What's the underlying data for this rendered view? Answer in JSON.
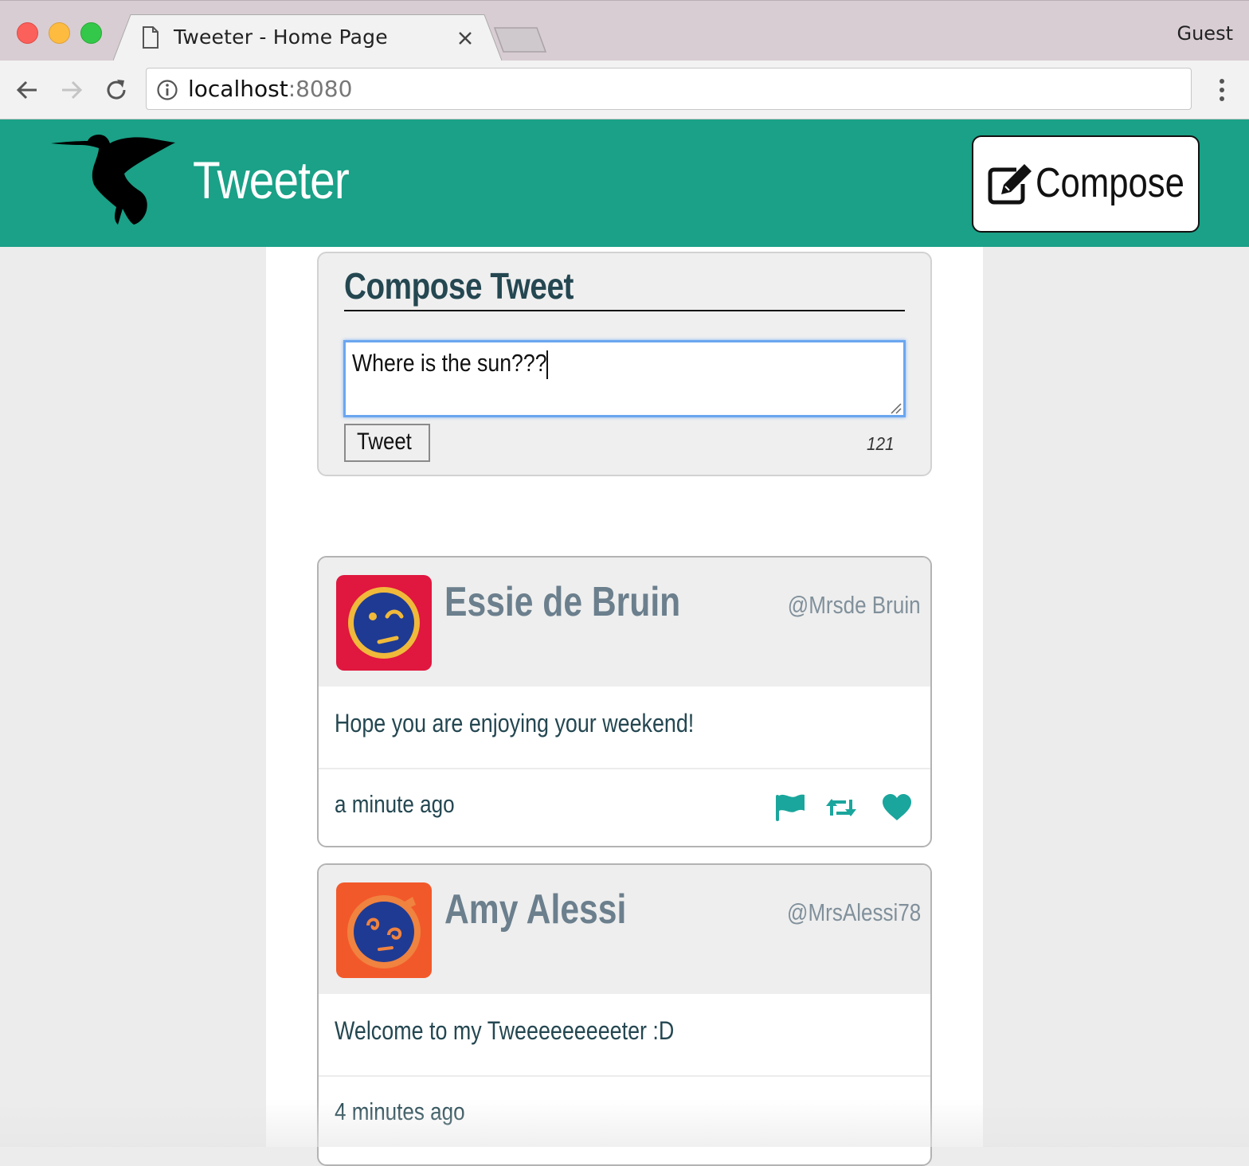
{
  "browser": {
    "tab_title": "Tweeter - Home Page",
    "profile_label": "Guest",
    "url_host": "localhost",
    "url_port": ":8080"
  },
  "header": {
    "brand": "Tweeter",
    "compose_button_label": "Compose",
    "accent_color": "#1aa187"
  },
  "compose": {
    "heading": "Compose Tweet",
    "textarea_value": "Where is the sun???",
    "submit_label": "Tweet",
    "char_counter": "121"
  },
  "tweets": [
    {
      "name": "Essie de Bruin",
      "handle": "@Mrsde Bruin",
      "text": "Hope you are enjoying your weekend!",
      "time": "a minute ago",
      "avatar_icon": "winking-face-avatar",
      "actions": [
        "flag-icon",
        "retweet-icon",
        "heart-icon"
      ]
    },
    {
      "name": "Amy Alessi",
      "handle": "@MrsAlessi78",
      "text": "Welcome to my Tweeeeeeeeeter :D",
      "time": "4 minutes ago",
      "avatar_icon": "dizzy-face-avatar"
    }
  ]
}
